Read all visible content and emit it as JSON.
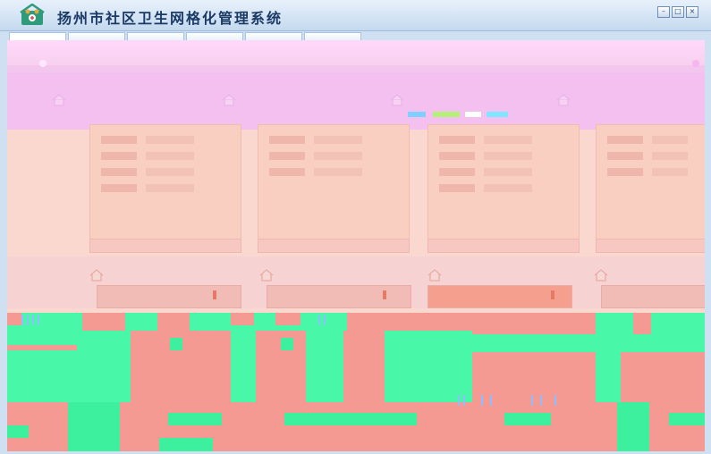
{
  "window": {
    "title": "扬州市社区卫生网格化管理系统",
    "controls": [
      "–",
      "□",
      "×"
    ]
  },
  "tabs": [
    "",
    "",
    "",
    "",
    "",
    ""
  ],
  "colors": {
    "accent": "#1b3a66",
    "tab_border": "#a9c3e2",
    "pink": "#f3c0ef",
    "green": "#49f7a8",
    "salmon": "#f59a92"
  },
  "icons": [
    "app-logo-icon",
    "home-icon",
    "minimize-icon",
    "maximize-icon",
    "close-icon"
  ]
}
